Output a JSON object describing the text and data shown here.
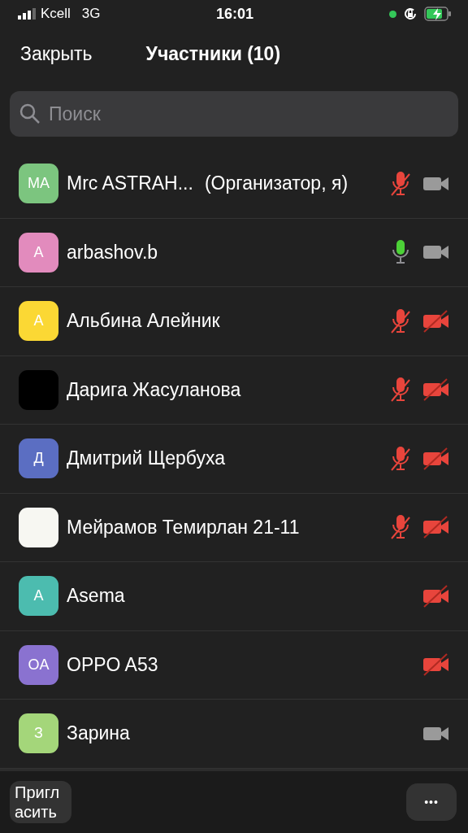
{
  "status_bar": {
    "carrier": "Kcell",
    "network": "3G",
    "time": "16:01"
  },
  "nav": {
    "close": "Закрыть",
    "title": "Участники (10)"
  },
  "search": {
    "placeholder": "Поиск"
  },
  "participants": [
    {
      "initials": "MA",
      "color": "#7cc57f",
      "name": "Mrc ASTRAH...",
      "role": "(Организатор, я)",
      "mic": {
        "muted": true
      },
      "video_off": false
    },
    {
      "initials": "A",
      "color": "#e28bbd",
      "name": "arbashov.b",
      "mic": {
        "muted": false,
        "speaking": true
      },
      "video_off": false
    },
    {
      "initials": "A",
      "color": "#fbd834",
      "name": "Альбина Алейник",
      "mic": {
        "muted": true
      },
      "video_off": true
    },
    {
      "color": "#000000",
      "name": "Дарига Жасуланова",
      "mic": {
        "muted": true
      },
      "video_off": true
    },
    {
      "initials": "Д",
      "color": "#5b6ec2",
      "name": "Дмитрий Щербуха",
      "mic": {
        "muted": true
      },
      "video_off": true
    },
    {
      "color": "#f7f7f2",
      "name": "Мейрамов Темирлан 21-11",
      "mic": {
        "muted": true
      },
      "video_off": true
    },
    {
      "initials": "A",
      "color": "#4cbcaf",
      "name": "Asema",
      "video_off": true
    },
    {
      "initials": "OA",
      "color": "#8a72d0",
      "name": "OPPO A53",
      "video_off": true
    },
    {
      "initials": "З",
      "color": "#a4d67a",
      "name": "Зарина",
      "video_off": false
    }
  ],
  "footer": {
    "invite": "Пригласить",
    "more": "•••"
  }
}
